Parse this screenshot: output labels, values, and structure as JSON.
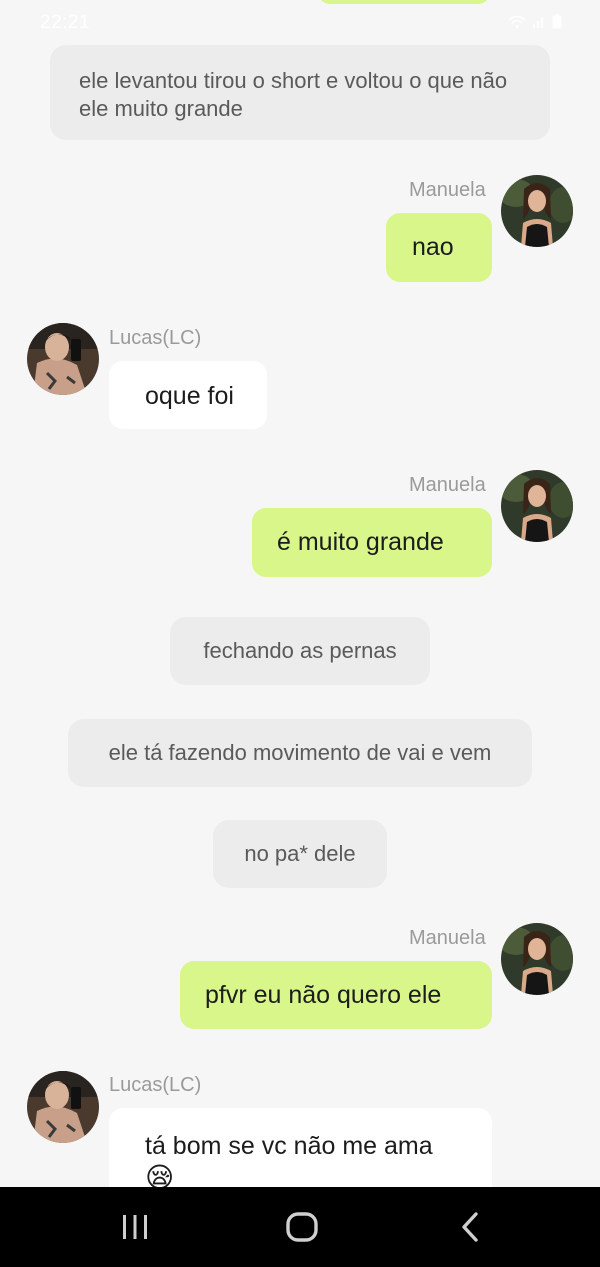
{
  "status_bar": {
    "time": "22:21"
  },
  "messages": [
    {
      "type": "narration",
      "text": "ele levantou tirou o short e voltou o que não ele muito grande"
    },
    {
      "type": "outgoing",
      "sender": "Manuela",
      "text": "nao"
    },
    {
      "type": "incoming",
      "sender": "Lucas(LC)",
      "text": "oque foi"
    },
    {
      "type": "outgoing",
      "sender": "Manuela",
      "text": "é muito grande"
    },
    {
      "type": "narration",
      "text": "fechando as pernas"
    },
    {
      "type": "narration",
      "text": "ele tá fazendo movimento de vai e vem"
    },
    {
      "type": "narration",
      "text": "no pa* dele"
    },
    {
      "type": "outgoing",
      "sender": "Manuela",
      "text": "pfvr eu não quero ele"
    },
    {
      "type": "incoming",
      "sender": "Lucas(LC)",
      "text": "tá bom se vc não me ama",
      "emoji": "😪"
    }
  ],
  "colors": {
    "outgoing_bubble": "#d9f68b",
    "incoming_bubble": "#ffffff",
    "narration_bubble": "#ececec",
    "background": "#f6f6f6",
    "navbar": "#000000"
  },
  "navbar": {
    "recents_icon": "recent-apps-icon",
    "home_icon": "home-icon",
    "back_icon": "back-icon"
  }
}
